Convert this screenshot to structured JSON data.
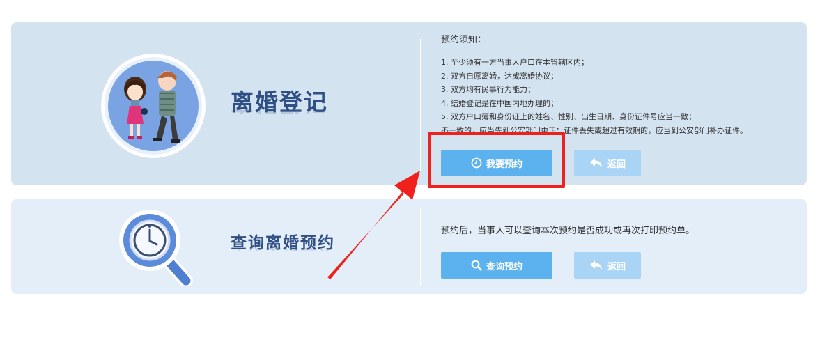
{
  "panels": {
    "divorce_registration": {
      "heading": "离婚登记",
      "notice_title": "预约须知：",
      "notice_items": [
        "1.  至少须有一方当事人户口在本管辖区内；",
        "2.    双方自愿离婚，达成离婚协议；",
        "3.    双方均有民事行为能力；",
        "4.    结婚登记是在中国内地办理的；",
        "5.  双方户口簿和身份证上的姓名、性别、出生日期、身份证件号应当一致；",
        "     不一致的，应当先到公安部门更正；证件丢失或超过有效期的，应当到公安部门补办证件。"
      ],
      "book_button": "我要预约",
      "back_button": "返回"
    },
    "query": {
      "heading": "查询离婚预约",
      "description": "预约后，当事人可以查询本次预约是否成功或再次打印预约单。",
      "query_button": "查询预约",
      "back_button": "返回"
    }
  },
  "icons": {
    "book": "clock-icon",
    "query": "search-icon",
    "back": "return-arrow-icon",
    "illustration1": "couple-illustration",
    "illustration2": "magnifier-clock-illustration"
  },
  "colors": {
    "panel1_bg": "#d4e3f0",
    "panel2_bg": "#e3eef8",
    "primary_button": "#5bb2ee",
    "back_button": "#a9d4f5",
    "heading": "#2f4f86",
    "highlight": "#f0201c"
  }
}
